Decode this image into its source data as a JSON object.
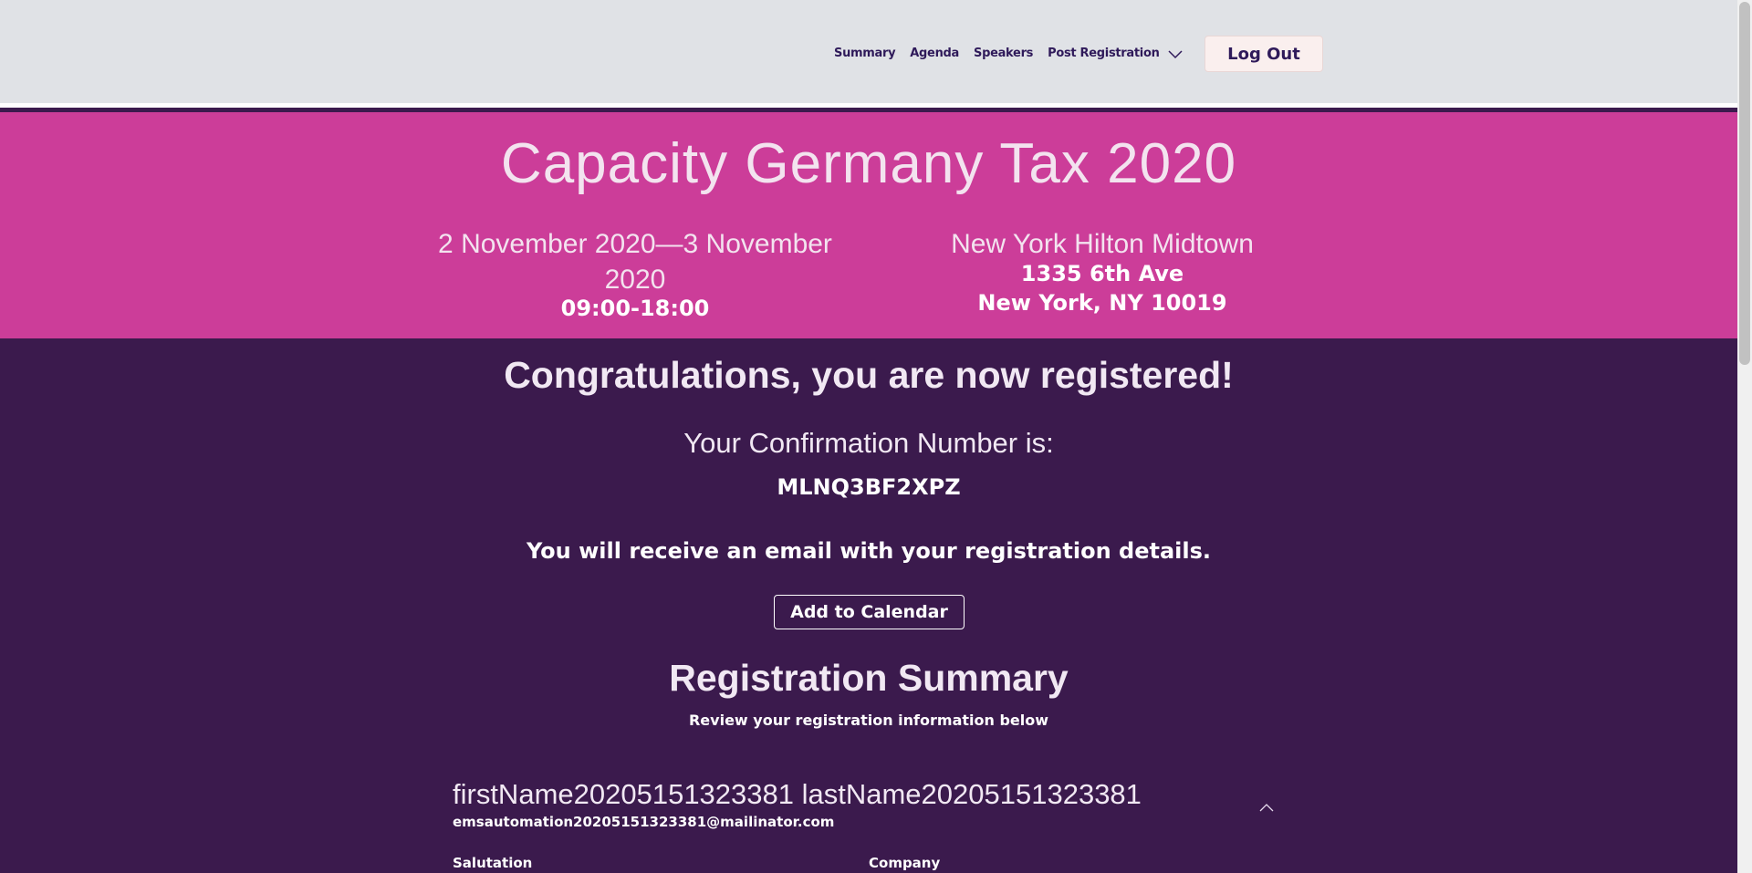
{
  "header": {
    "nav": [
      "Summary",
      "Agenda",
      "Speakers",
      "Post Registration"
    ],
    "logout_label": "Log Out"
  },
  "event": {
    "title": "Capacity Germany Tax 2020",
    "dates": "2 November 2020—3 November 2020",
    "time": "09:00-18:00",
    "venue": "New York Hilton Midtown",
    "address_line1": "1335 6th Ave",
    "address_line2": "New York, NY 10019"
  },
  "confirmation": {
    "heading": "Congratulations, you are now registered!",
    "number_label": "Your Confirmation Number is:",
    "number": "MLNQ3BF2XPZ",
    "email_note": "You will receive an email with your registration details.",
    "calendar_button": "Add to Calendar"
  },
  "summary": {
    "title": "Registration Summary",
    "subtitle": "Review your registration information below",
    "full_name": "firstName20205151323381 lastName20205151323381",
    "email": "emsautomation20205151323381@mailinator.com",
    "fields": [
      "Salutation",
      "Company"
    ]
  },
  "colors": {
    "header_bg": "#e0e2e6",
    "banner_bg": "#cc3d99",
    "main_bg": "#3b1a4d",
    "nav_text": "#2f1a5a"
  },
  "icons": {
    "dropdown": "chevron-down-icon",
    "collapse": "chevron-up-icon"
  }
}
